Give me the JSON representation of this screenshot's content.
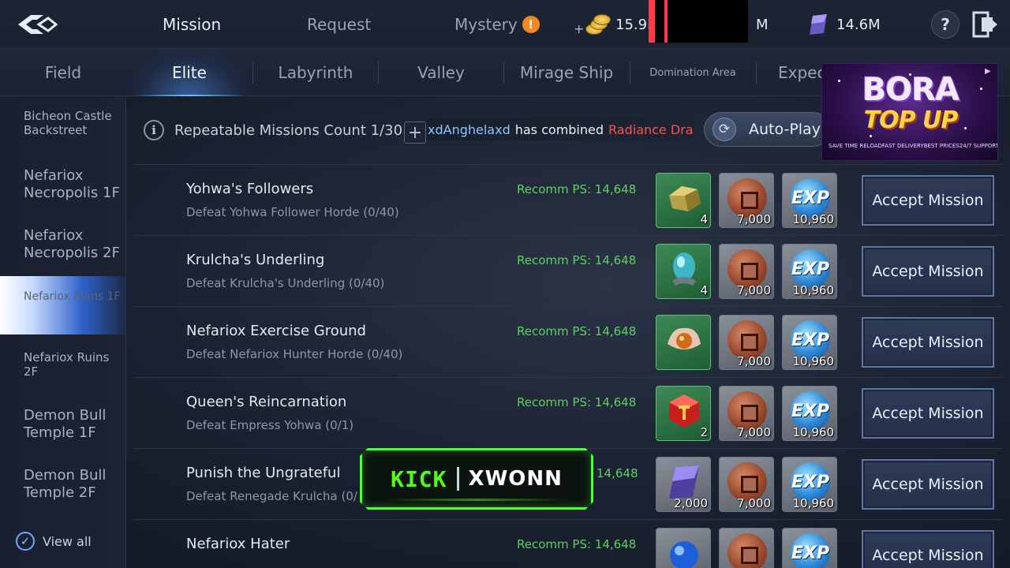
{
  "top_tabs": [
    {
      "label": "Mission",
      "active": true
    },
    {
      "label": "Request",
      "active": false
    },
    {
      "label": "Mystery",
      "active": false,
      "alert": "!"
    }
  ],
  "currencies": {
    "gold": "15.9K",
    "redacted_suffix": "M",
    "crystal": "14.6M"
  },
  "help_label": "?",
  "sub_tabs": [
    {
      "label": "Field",
      "active": false
    },
    {
      "label": "Elite",
      "active": true
    },
    {
      "label": "Labyrinth",
      "active": false
    },
    {
      "label": "Valley",
      "active": false
    },
    {
      "label": "Mirage Ship",
      "active": false
    },
    {
      "label": "Domination Area",
      "active": false
    },
    {
      "label": "Expec",
      "active": false
    }
  ],
  "sidebar": {
    "items": [
      {
        "label": "Bicheon Castle Backstreet",
        "active": false
      },
      {
        "label": "Nefariox Necropolis 1F",
        "active": false
      },
      {
        "label": "Nefariox Necropolis 2F",
        "active": false
      },
      {
        "label": "Nefariox Ruins 1F",
        "active": true
      },
      {
        "label": "Nefariox Ruins 2F",
        "active": false
      },
      {
        "label": "Demon Bull Temple 1F",
        "active": false
      },
      {
        "label": "Demon Bull Temple 2F",
        "active": false
      }
    ],
    "view_all": "View all",
    "view_all_checked": true
  },
  "info": {
    "icon": "info-icon",
    "repeatable_text": "Repeatable Missions Count 1/30",
    "plus": "+",
    "ticker_user": "xdAnghelaxd",
    "ticker_mid": "has combined",
    "ticker_item": "Radiance Drago",
    "auto_play": "Auto-Play"
  },
  "ad": {
    "line1": "BORA",
    "line2": "TOP UP",
    "features": [
      "SAVE TIME RELOAD",
      "FAST DELIVERY",
      "BEST PRICES",
      "24/7 SUPPORT"
    ]
  },
  "missions": [
    {
      "title": "Yohwa's Followers",
      "objective": "Defeat Yohwa Follower Horde (0/40)",
      "ps": "Recomm PS: 14,648",
      "rewards": [
        {
          "icon": "gold-ore-icon",
          "qty": "4",
          "frame": "green"
        },
        {
          "icon": "coin-icon",
          "qty": "7,000",
          "frame": "grey"
        },
        {
          "icon": "exp-icon",
          "qty": "10,960",
          "frame": "grey"
        }
      ],
      "button": "Accept Mission"
    },
    {
      "title": "Krulcha's Underling",
      "objective": "Defeat Krulcha's Underling (0/40)",
      "ps": "Recomm PS: 14,648",
      "rewards": [
        {
          "icon": "egg-icon",
          "qty": "4",
          "frame": "green"
        },
        {
          "icon": "coin-icon",
          "qty": "7,000",
          "frame": "grey"
        },
        {
          "icon": "exp-icon",
          "qty": "10,960",
          "frame": "grey"
        }
      ],
      "button": "Accept Mission"
    },
    {
      "title": "Nefariox Exercise Ground",
      "objective": "Defeat Nefariox Hunter Horde (0/40)",
      "ps": "Recomm PS: 14,648",
      "rewards": [
        {
          "icon": "pearl-icon",
          "qty": "",
          "frame": "green"
        },
        {
          "icon": "coin-icon",
          "qty": "7,000",
          "frame": "grey"
        },
        {
          "icon": "exp-icon",
          "qty": "10,960",
          "frame": "grey"
        }
      ],
      "button": "Accept Mission"
    },
    {
      "title": "Queen's Reincarnation",
      "objective": "Defeat Empress Yohwa (0/1)",
      "ps": "Recomm PS: 14,648",
      "rewards": [
        {
          "icon": "red-gem-icon",
          "qty": "2",
          "frame": "green"
        },
        {
          "icon": "coin-icon",
          "qty": "7,000",
          "frame": "grey"
        },
        {
          "icon": "exp-icon",
          "qty": "10,960",
          "frame": "grey"
        }
      ],
      "button": "Accept Mission"
    },
    {
      "title": "Punish the Ungrateful",
      "objective": "Defeat Renegade Krulcha (0/",
      "ps": "14,648",
      "rewards": [
        {
          "icon": "crystal-icon",
          "qty": "2,000",
          "frame": "grey"
        },
        {
          "icon": "coin-icon",
          "qty": "7,000",
          "frame": "grey"
        },
        {
          "icon": "exp-icon",
          "qty": "10,960",
          "frame": "grey"
        }
      ],
      "button": "Accept Mission"
    },
    {
      "title": "Nefariox Hater",
      "objective": "",
      "ps": "Recomm PS: 14,648",
      "rewards": [
        {
          "icon": "blue-orb-icon",
          "qty": "",
          "frame": "grey"
        },
        {
          "icon": "coin-icon",
          "qty": "",
          "frame": "grey"
        },
        {
          "icon": "exp-icon",
          "qty": "",
          "frame": "grey"
        }
      ],
      "button": "Accept Mission"
    }
  ],
  "exp_label": "EXP",
  "overlay": {
    "left": "KICK",
    "right": "XWONN"
  }
}
